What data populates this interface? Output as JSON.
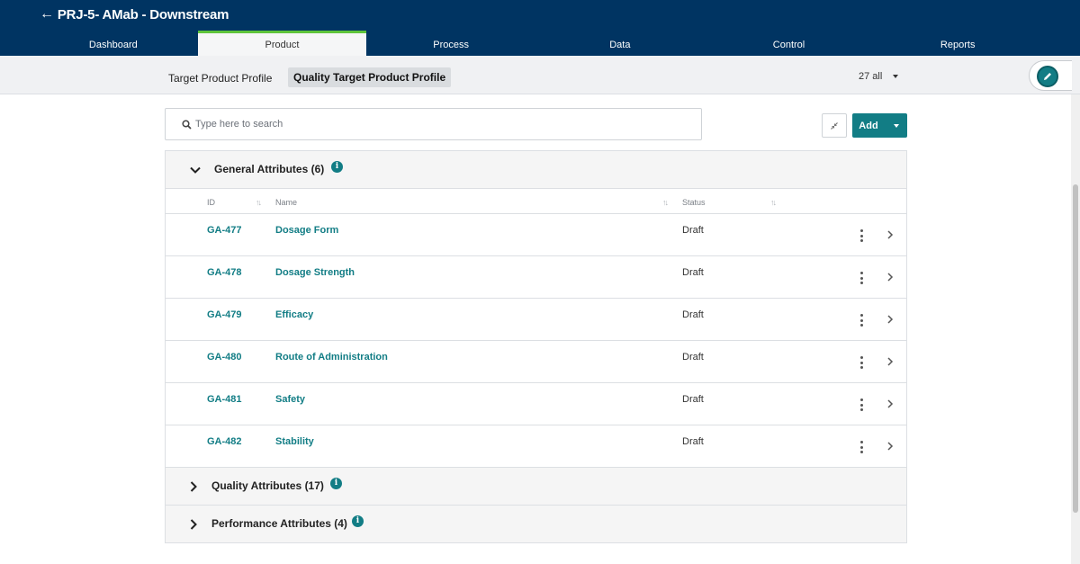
{
  "header": {
    "back_label": "←",
    "title": "PRJ-5- AMab - Downstream"
  },
  "nav": {
    "tabs": [
      {
        "label": "Dashboard"
      },
      {
        "label": "Product"
      },
      {
        "label": "Process"
      },
      {
        "label": "Data"
      },
      {
        "label": "Control"
      },
      {
        "label": "Reports"
      }
    ],
    "active": "Product"
  },
  "subnav": {
    "tabs": [
      {
        "label": "Target Product Profile"
      },
      {
        "label": "Quality Target Product Profile"
      }
    ],
    "active": "Quality Target Product Profile",
    "filter_label": "27 all"
  },
  "search": {
    "placeholder": "Type here to search"
  },
  "toolbar": {
    "add_label": "Add"
  },
  "columns": {
    "id": "ID",
    "name": "Name",
    "status": "Status"
  },
  "groups": [
    {
      "title": "General Attributes (6)",
      "expanded": true,
      "rows": [
        {
          "id": "GA-477",
          "name": "Dosage Form",
          "status": "Draft"
        },
        {
          "id": "GA-478",
          "name": "Dosage Strength",
          "status": "Draft"
        },
        {
          "id": "GA-479",
          "name": "Efficacy",
          "status": "Draft"
        },
        {
          "id": "GA-480",
          "name": "Route of Administration",
          "status": "Draft"
        },
        {
          "id": "GA-481",
          "name": "Safety",
          "status": "Draft"
        },
        {
          "id": "GA-482",
          "name": "Stability",
          "status": "Draft"
        }
      ]
    },
    {
      "title": "Quality Attributes (17)",
      "expanded": false
    },
    {
      "title": "Performance Attributes (4)",
      "expanded": false
    }
  ],
  "colors": {
    "header_bg": "#003462",
    "accent": "#127d85",
    "active_tab_border": "#5ec43b"
  },
  "icons": {
    "info": "info-icon",
    "edit": "pencil-icon",
    "collapse": "collapse-icon",
    "row_menu": "kebab-icon",
    "row_open": "chevron-right-icon"
  }
}
